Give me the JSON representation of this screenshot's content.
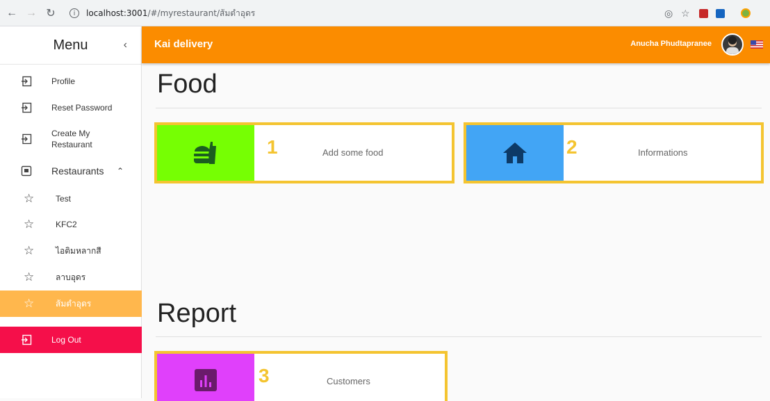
{
  "browser": {
    "url_host": "localhost:3001",
    "url_path": "/#/myrestaurant/ส้มตำอุดร"
  },
  "sidebar": {
    "title": "Menu",
    "items": [
      {
        "label": "Profile"
      },
      {
        "label": "Reset Password"
      },
      {
        "label": "Create My Restaurant"
      },
      {
        "label": "Restaurants"
      }
    ],
    "restaurants": [
      {
        "label": "Test"
      },
      {
        "label": "KFC2"
      },
      {
        "label": "ไอติมหลากสี"
      },
      {
        "label": "ลาบอุดร"
      },
      {
        "label": "ส้มตำอุดร"
      }
    ],
    "logout_label": "Log Out"
  },
  "appbar": {
    "brand": "Kai delivery",
    "user_name": "Anucha Phudtapranee"
  },
  "sections": {
    "food_title": "Food",
    "report_title": "Report"
  },
  "cards": [
    {
      "number": "1",
      "label": "Add some food",
      "color": "#76ff03"
    },
    {
      "number": "2",
      "label": "Informations",
      "color": "#42a5f5"
    },
    {
      "number": "3",
      "label": "Customers",
      "color": "#e040fb"
    }
  ],
  "colors": {
    "accent": "#fb8c00",
    "active_item": "#ffb74d",
    "logout": "#f50f4a",
    "card_border": "#f4c430"
  }
}
